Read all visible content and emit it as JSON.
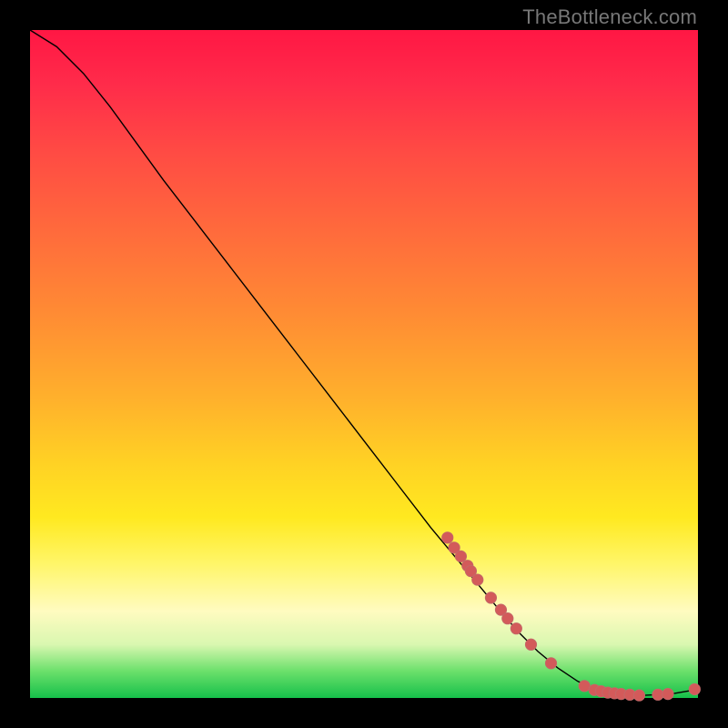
{
  "watermark": "TheBottleneck.com",
  "chart_data": {
    "type": "line",
    "title": "",
    "xlabel": "",
    "ylabel": "",
    "xlim": [
      0,
      100
    ],
    "ylim": [
      0,
      100
    ],
    "grid": false,
    "legend": false,
    "curve": {
      "name": "bottleneck-curve",
      "color": "#000000",
      "width": 1.4,
      "points": [
        {
          "x": 0,
          "y": 100
        },
        {
          "x": 4,
          "y": 97.5
        },
        {
          "x": 8,
          "y": 93.5
        },
        {
          "x": 12,
          "y": 88.5
        },
        {
          "x": 16,
          "y": 83
        },
        {
          "x": 20,
          "y": 77.5
        },
        {
          "x": 25,
          "y": 71
        },
        {
          "x": 30,
          "y": 64.5
        },
        {
          "x": 35,
          "y": 58
        },
        {
          "x": 40,
          "y": 51.5
        },
        {
          "x": 45,
          "y": 45
        },
        {
          "x": 50,
          "y": 38.5
        },
        {
          "x": 55,
          "y": 32
        },
        {
          "x": 60,
          "y": 25.5
        },
        {
          "x": 65,
          "y": 19.5
        },
        {
          "x": 70,
          "y": 13.5
        },
        {
          "x": 73,
          "y": 10
        },
        {
          "x": 76,
          "y": 7
        },
        {
          "x": 79,
          "y": 4.5
        },
        {
          "x": 82,
          "y": 2.5
        },
        {
          "x": 85,
          "y": 1.2
        },
        {
          "x": 88,
          "y": 0.6
        },
        {
          "x": 92,
          "y": 0.4
        },
        {
          "x": 96,
          "y": 0.6
        },
        {
          "x": 100,
          "y": 1.3
        }
      ]
    },
    "scatter": {
      "name": "highlighted-points",
      "color": "#d35a5a",
      "stroke": "#c16a6a",
      "radius": 6.2,
      "points": [
        {
          "x": 62.5,
          "y": 24.0
        },
        {
          "x": 63.5,
          "y": 22.5
        },
        {
          "x": 64.5,
          "y": 21.2
        },
        {
          "x": 65.5,
          "y": 19.8
        },
        {
          "x": 66.0,
          "y": 19.0
        },
        {
          "x": 67.0,
          "y": 17.7
        },
        {
          "x": 69.0,
          "y": 15.0
        },
        {
          "x": 70.5,
          "y": 13.2
        },
        {
          "x": 71.5,
          "y": 11.9
        },
        {
          "x": 72.8,
          "y": 10.4
        },
        {
          "x": 75.0,
          "y": 8.0
        },
        {
          "x": 78.0,
          "y": 5.2
        },
        {
          "x": 83.0,
          "y": 1.8
        },
        {
          "x": 84.5,
          "y": 1.2
        },
        {
          "x": 85.5,
          "y": 1.0
        },
        {
          "x": 86.5,
          "y": 0.8
        },
        {
          "x": 87.5,
          "y": 0.7
        },
        {
          "x": 88.5,
          "y": 0.6
        },
        {
          "x": 89.8,
          "y": 0.5
        },
        {
          "x": 91.2,
          "y": 0.4
        },
        {
          "x": 94.0,
          "y": 0.5
        },
        {
          "x": 95.5,
          "y": 0.6
        },
        {
          "x": 99.5,
          "y": 1.3
        }
      ]
    }
  }
}
